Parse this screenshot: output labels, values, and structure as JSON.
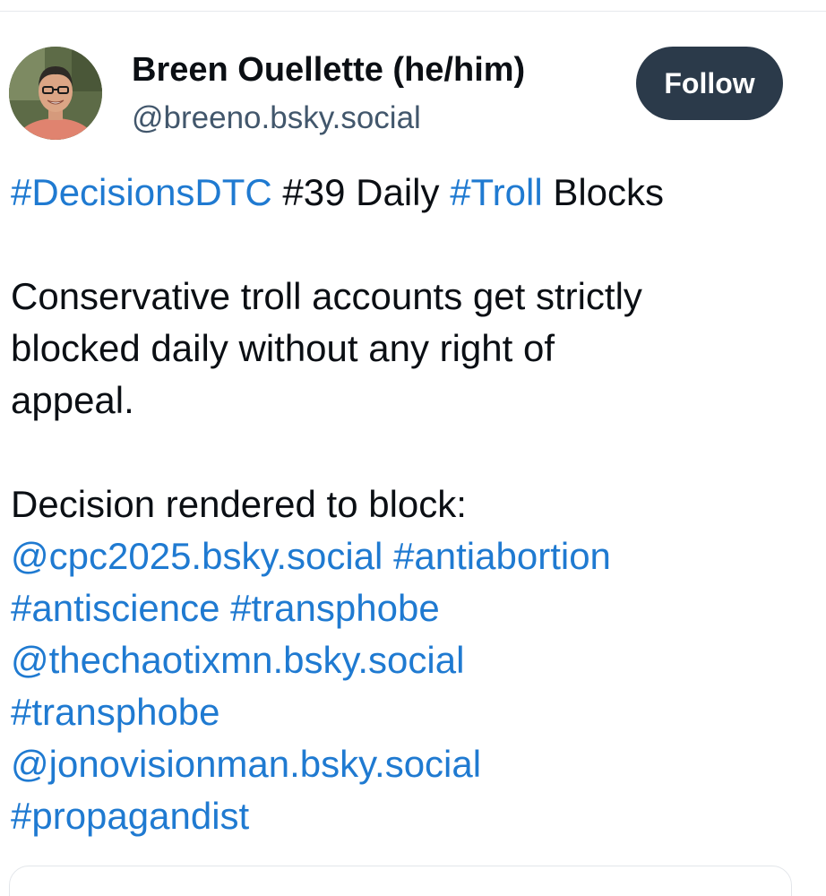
{
  "author": {
    "display_name": "Breen Ouellette (he/him)",
    "handle": "@breeno.bsky.social",
    "avatar_icon": "profile-photo-avatar"
  },
  "follow_button": {
    "label": "Follow"
  },
  "post": {
    "title_line": {
      "tag1": "#DecisionsDTC",
      "text1": " #39 Daily ",
      "tag2": "#Troll",
      "text2": " Blocks"
    },
    "paragraph1": {
      "line1": "Conservative troll accounts get strictly",
      "line2": "blocked daily without any right of",
      "line3": "appeal."
    },
    "decision_heading": "Decision rendered to block:",
    "blocked": [
      {
        "account": "@cpc2025.bsky.social",
        "tags": [
          "#antiabortion",
          "#antiscience",
          "#transphobe"
        ]
      },
      {
        "account": "@thechaotixmn.bsky.social",
        "tags": [
          "#transphobe"
        ]
      },
      {
        "account": "@jonovisionman.bsky.social",
        "tags": [
          "#propagandist"
        ]
      }
    ]
  },
  "colors": {
    "link": "#1f7ad1",
    "text": "#0b0f14",
    "handle": "#42576c",
    "follow_bg": "#2b3a4a",
    "follow_text": "#ffffff"
  }
}
